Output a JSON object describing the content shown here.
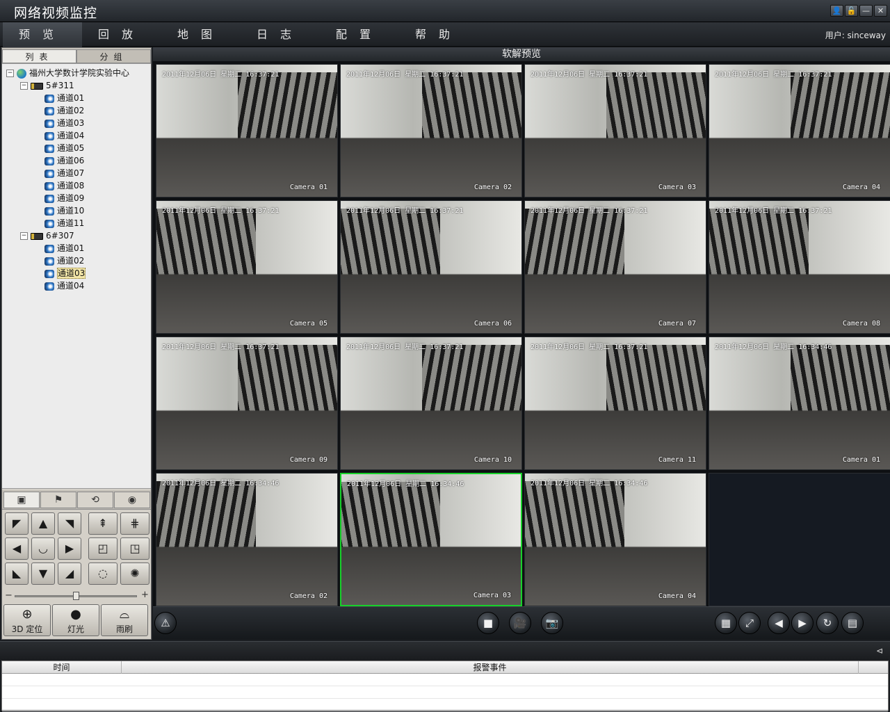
{
  "app": {
    "title": "网络视频监控",
    "user_label": "用户: sinceway"
  },
  "window_buttons": [
    {
      "name": "user-icon",
      "glyph": "👤"
    },
    {
      "name": "lock-icon",
      "glyph": "🔓"
    },
    {
      "name": "minimize-icon",
      "glyph": "—"
    },
    {
      "name": "close-icon",
      "glyph": "✕"
    }
  ],
  "menu": [
    {
      "label": "预览",
      "active": true
    },
    {
      "label": "回放 ▾",
      "active": false
    },
    {
      "label": "地图",
      "active": false
    },
    {
      "label": "日志",
      "active": false
    },
    {
      "label": "配置",
      "active": false
    },
    {
      "label": "帮助",
      "active": false
    }
  ],
  "left_tabs": [
    "列表",
    "分组"
  ],
  "tree": [
    {
      "level": 0,
      "type": "root",
      "label": "福州大学数计学院实验中心",
      "expander": "−"
    },
    {
      "level": 1,
      "type": "dvr",
      "label": "5#311",
      "expander": "−"
    },
    {
      "level": 2,
      "type": "cam",
      "label": "通道01"
    },
    {
      "level": 2,
      "type": "cam",
      "label": "通道02"
    },
    {
      "level": 2,
      "type": "cam",
      "label": "通道03"
    },
    {
      "level": 2,
      "type": "cam",
      "label": "通道04"
    },
    {
      "level": 2,
      "type": "cam",
      "label": "通道05"
    },
    {
      "level": 2,
      "type": "cam",
      "label": "通道06"
    },
    {
      "level": 2,
      "type": "cam",
      "label": "通道07"
    },
    {
      "level": 2,
      "type": "cam",
      "label": "通道08"
    },
    {
      "level": 2,
      "type": "cam",
      "label": "通道09"
    },
    {
      "level": 2,
      "type": "cam",
      "label": "通道10"
    },
    {
      "level": 2,
      "type": "cam",
      "label": "通道11"
    },
    {
      "level": 1,
      "type": "dvr",
      "label": "6#307",
      "expander": "−"
    },
    {
      "level": 2,
      "type": "cam",
      "label": "通道01"
    },
    {
      "level": 2,
      "type": "cam",
      "label": "通道02"
    },
    {
      "level": 2,
      "type": "cam",
      "label": "通道03",
      "selected": true
    },
    {
      "level": 2,
      "type": "cam",
      "label": "通道04"
    }
  ],
  "ptz_tabs": [
    {
      "name": "ptz-control-tab-icon",
      "glyph": "▣",
      "active": true
    },
    {
      "name": "preset-flag-tab-icon",
      "glyph": "⚑",
      "active": false
    },
    {
      "name": "cruise-tab-icon",
      "glyph": "⟲",
      "active": false
    },
    {
      "name": "color-adjust-tab-icon",
      "glyph": "◉",
      "active": false
    }
  ],
  "ptz_buttons": [
    {
      "name": "ptz-up-left-button",
      "glyph": "◤"
    },
    {
      "name": "ptz-up-button",
      "glyph": "▲"
    },
    {
      "name": "ptz-up-right-button",
      "glyph": "◥"
    },
    {
      "name": "zoom-in-button",
      "glyph": "⇞"
    },
    {
      "name": "zoom-out-button",
      "glyph": "⋕"
    },
    {
      "name": "ptz-left-button",
      "glyph": "◀"
    },
    {
      "name": "ptz-auto-button",
      "glyph": "◡"
    },
    {
      "name": "ptz-right-button",
      "glyph": "▶"
    },
    {
      "name": "focus-near-button",
      "glyph": "◰"
    },
    {
      "name": "focus-far-button",
      "glyph": "◳"
    },
    {
      "name": "ptz-down-left-button",
      "glyph": "◣"
    },
    {
      "name": "ptz-down-button",
      "glyph": "▼"
    },
    {
      "name": "ptz-down-right-button",
      "glyph": "◢"
    },
    {
      "name": "iris-open-button",
      "glyph": "◌"
    },
    {
      "name": "iris-close-button",
      "glyph": "✺"
    }
  ],
  "speed_slider": {
    "minus": "−",
    "plus": "+",
    "value": 0.5
  },
  "ptz_big_buttons": [
    {
      "name": "3d-position-button",
      "icon": "magnifier-icon",
      "glyph": "⊕",
      "label": "3D 定位"
    },
    {
      "name": "light-button",
      "icon": "bulb-icon",
      "glyph": "●",
      "label": "灯光"
    },
    {
      "name": "wiper-button",
      "icon": "wiper-icon",
      "glyph": "⌓",
      "label": "雨刷"
    }
  ],
  "video": {
    "header": "软解预览",
    "tiles": [
      {
        "ts": "2011年12月06日 星期二 16:37:21",
        "cam": "Camera 01"
      },
      {
        "ts": "2011年12月06日 星期二 16:37:21",
        "cam": "Camera 02"
      },
      {
        "ts": "2011年12月06日 星期二 16:37:21",
        "cam": "Camera 03"
      },
      {
        "ts": "2011年12月06日 星期二 16:37:21",
        "cam": "Camera 04"
      },
      {
        "ts": "2011年12月06日 星期二 16:37:21",
        "cam": "Camera 05"
      },
      {
        "ts": "2011年12月06日 星期二 16:37:21",
        "cam": "Camera 06"
      },
      {
        "ts": "2011年12月06日 星期二 16:37:21",
        "cam": "Camera 07"
      },
      {
        "ts": "2011年12月06日 星期二 16:37:21",
        "cam": "Camera 08"
      },
      {
        "ts": "2011年12月06日 星期二 16:37:21",
        "cam": "Camera 09"
      },
      {
        "ts": "2011年12月06日 星期二 16:37:21",
        "cam": "Camera 10"
      },
      {
        "ts": "2011年12月06日 星期二 16:37:21",
        "cam": "Camera 11"
      },
      {
        "ts": "2011年12月06日 星期二 16:34:46",
        "cam": "Camera 01"
      },
      {
        "ts": "2011年12月06日 星期二 16:34:46",
        "cam": "Camera 02"
      },
      {
        "ts": "2011年12月06日 星期二 16:34:46",
        "cam": "Camera 03",
        "selected": true
      },
      {
        "ts": "2011年12月06日 星期二 16:34:46",
        "cam": "Camera 04"
      },
      {
        "ts": "",
        "cam": "",
        "empty": true
      }
    ]
  },
  "toolbar": {
    "alarm": {
      "name": "alarm-warning-button",
      "glyph": "⚠"
    },
    "center": [
      {
        "name": "stop-all-button",
        "glyph": "■"
      },
      {
        "name": "record-button",
        "glyph": "🎥"
      },
      {
        "name": "snapshot-button",
        "glyph": "📷"
      }
    ],
    "right": [
      {
        "name": "layout-split-button",
        "glyph": "▦"
      },
      {
        "name": "fullscreen-button",
        "glyph": "⤢"
      },
      {
        "name": "previous-page-button",
        "glyph": "◀"
      },
      {
        "name": "next-page-button",
        "glyph": "▶"
      },
      {
        "name": "cycle-button",
        "glyph": "↻"
      },
      {
        "name": "settings-button",
        "glyph": "▤"
      }
    ]
  },
  "alarm_panel": {
    "pin_glyph": "⊲",
    "col_time": "时间",
    "col_event": "报警事件",
    "rows": 3
  }
}
